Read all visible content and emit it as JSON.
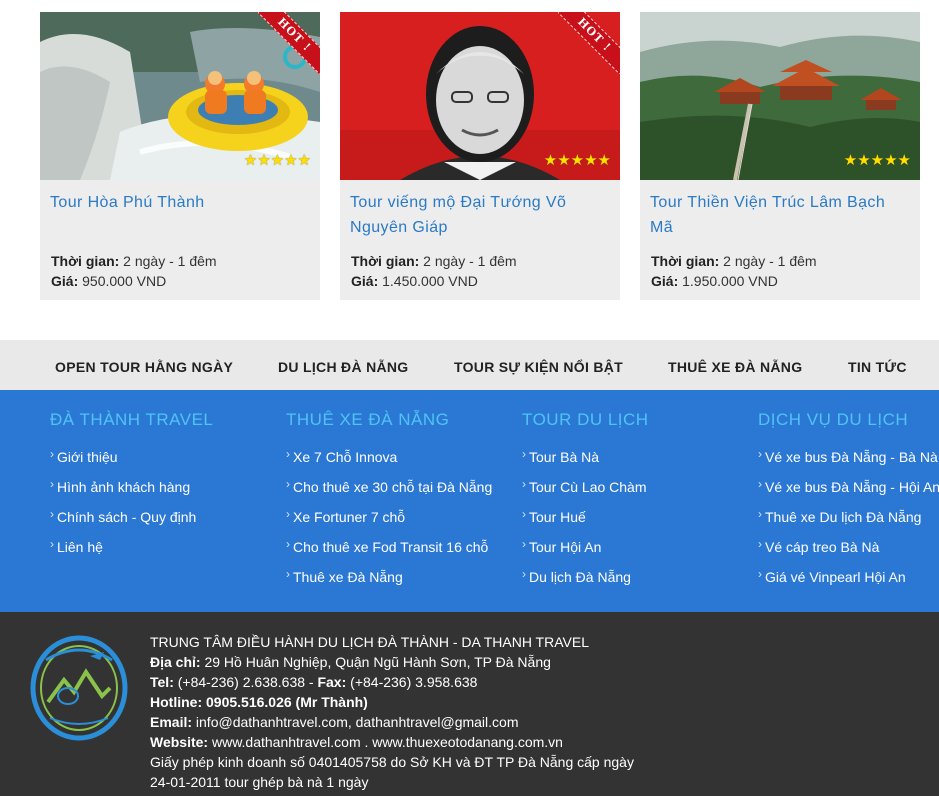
{
  "tours": [
    {
      "name": "Tour Hòa Phú Thành",
      "hot": true,
      "hot_label": "HOT !",
      "rating": 5,
      "time_label": "Thời gian:",
      "time_value": "2 ngày - 1 đêm",
      "price_label": "Giá:",
      "price_value": "950.000 VND",
      "image": "rafting-photo"
    },
    {
      "name": "Tour viếng mộ Đại Tướng Võ Nguyên Giáp",
      "hot": true,
      "hot_label": "HOT !",
      "rating": 5,
      "time_label": "Thời gian:",
      "time_value": "2 ngày - 1 đêm",
      "price_label": "Giá:",
      "price_value": "1.450.000 VND",
      "image": "general-portrait-photo"
    },
    {
      "name": "Tour Thiền Viện Trúc Lâm Bạch Mã",
      "hot": false,
      "rating": 5,
      "time_label": "Thời gian:",
      "time_value": "2 ngày - 1 đêm",
      "price_label": "Giá:",
      "price_value": "1.950.000 VND",
      "image": "mountain-pagoda-photo"
    }
  ],
  "menu": [
    "OPEN TOUR HẰNG NGÀY",
    "DU LỊCH ĐÀ NẴNG",
    "TOUR SỰ KIỆN NỔI BẬT",
    "THUÊ XE ĐÀ NẴNG",
    "TIN TỨC"
  ],
  "footer_columns": [
    {
      "title": "Đà Thành Travel",
      "items": [
        "Giới thiệu",
        "Hình ảnh khách hàng",
        "Chính sách - Quy định",
        "Liên hệ"
      ]
    },
    {
      "title": "Thuê xe Đà Nẵng",
      "items": [
        "Xe 7 Chỗ Innova",
        "Cho thuê xe 30 chỗ tại Đà Nẵng",
        "Xe Fortuner 7 chỗ",
        "Cho thuê xe Fod Transit 16 chỗ",
        "Thuê xe Đà Nẵng"
      ]
    },
    {
      "title": "Tour du lịch",
      "items": [
        "Tour Bà Nà",
        "Tour Cù Lao Chàm",
        "Tour Huế",
        "Tour Hội An",
        "Du lịch Đà Nẵng"
      ]
    },
    {
      "title": "Dịch vụ du lịch",
      "items": [
        "Vé xe bus Đà Nẵng - Bà Nà",
        "Vé xe bus Đà Nẵng - Hội An",
        "Thuê xe Du lịch Đà Nẵng",
        "Vé cáp treo Bà Nà",
        "Giá vé Vinpearl Hội An"
      ]
    }
  ],
  "company": {
    "name": "TRUNG TÂM ĐIỀU HÀNH DU LỊCH ĐÀ THÀNH - DA THANH TRAVEL",
    "address_label": "Địa chỉ:",
    "address": "29 Hồ Huân Nghiệp, Quận Ngũ Hành Sơn, TP Đà Nẵng",
    "tel_label": "Tel:",
    "tel": "(+84-236) 2.638.638",
    "fax_label": "Fax:",
    "fax": "(+84-236) 3.958.638",
    "hotline_label": "Hotline:",
    "hotline": "0905.516.026 (Mr Thành)",
    "email_label": "Email:",
    "email": "info@dathanhtravel.com, dathanhtravel@gmail.com",
    "website_label": "Website:",
    "website": "www.dathanhtravel.com . www.thuexeotodanang.com.vn",
    "license_line1": "Giấy phép kinh doanh số 0401405758 do Sở KH và ĐT TP Đà Nẵng cấp ngày",
    "license_line2": "24-01-2011 tour ghép bà nà 1 ngày",
    "logo_text": "Da Thanh Travel"
  },
  "colors": {
    "link_blue": "#2a7ac5",
    "footer_blue": "#2b78d4",
    "footer_heading": "#4fc3f7",
    "dark_footer": "#333333",
    "hot_red": "#c8101a",
    "star_yellow": "#ffde00"
  }
}
